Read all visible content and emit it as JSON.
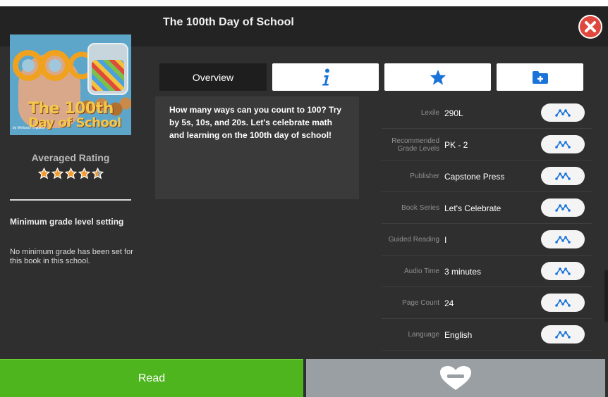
{
  "window": {
    "title": "The 100th Day of School"
  },
  "cover": {
    "title_line1": "The 100th",
    "title_line2": "Day of School",
    "byline": "by Melissa Ferguson"
  },
  "rating": {
    "label": "Averaged Rating",
    "value": 4.5,
    "max": 5
  },
  "min_grade": {
    "title": "Minimum grade level setting",
    "description": "No minimum grade has been set for this book in this school."
  },
  "tabs": [
    {
      "label": "Overview",
      "icon": null,
      "selected": true
    },
    {
      "label": "",
      "icon": "info-icon",
      "selected": false
    },
    {
      "label": "",
      "icon": "star-icon",
      "selected": false
    },
    {
      "label": "",
      "icon": "folder-add-icon",
      "selected": false
    }
  ],
  "description": "How many ways can you count to 100? Try by 5s, 10s, and 20s. Let's celebrate math and learning on the 100th day of school!",
  "details": [
    {
      "label": "Lexile",
      "value": "290L"
    },
    {
      "label": "Recommended Grade Levels",
      "value": "PK - 2"
    },
    {
      "label": "Publisher",
      "value": "Capstone Press"
    },
    {
      "label": "Book Series",
      "value": "Let's Celebrate"
    },
    {
      "label": "Guided Reading",
      "value": "I"
    },
    {
      "label": "Audio Time",
      "value": "3 minutes"
    },
    {
      "label": "Page Count",
      "value": "24"
    },
    {
      "label": "Language",
      "value": "English"
    }
  ],
  "actions": {
    "read_label": "Read",
    "favorite_icon": "heart-minus-icon"
  },
  "colors": {
    "accent_blue": "#1a73d9",
    "read_green": "#4fb51e",
    "close_red": "#e0473d",
    "star_orange": "#f29a2e"
  }
}
